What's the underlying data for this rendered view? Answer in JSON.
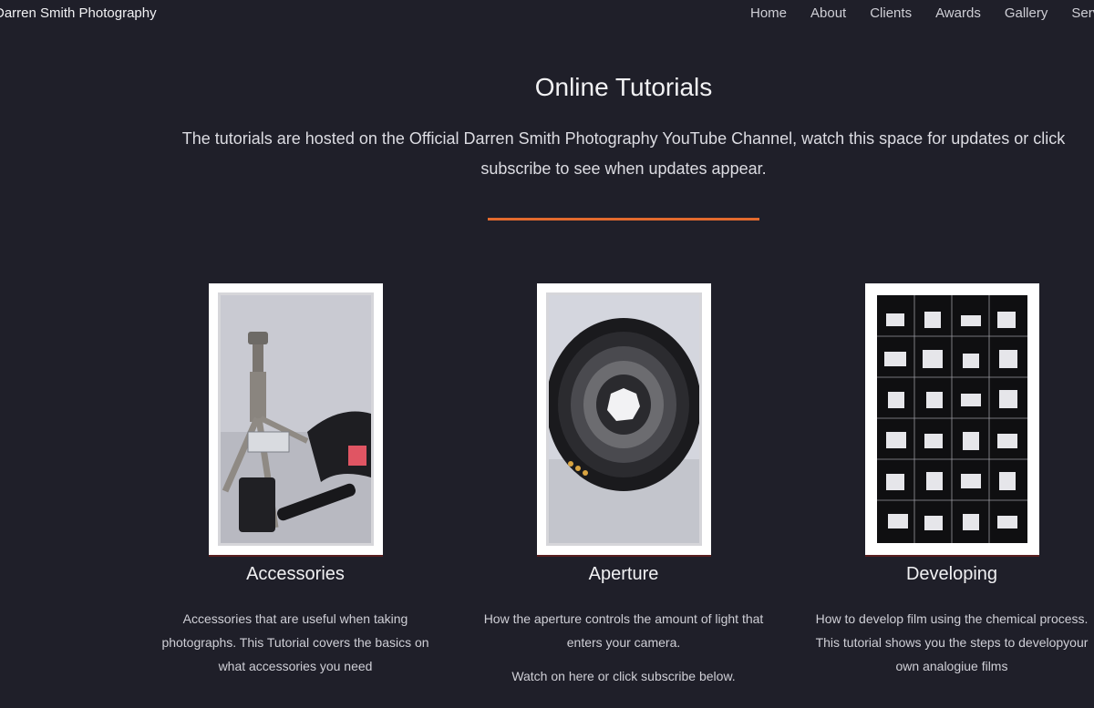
{
  "header": {
    "brand": "Darren Smith Photography",
    "nav": [
      "Home",
      "About",
      "Clients",
      "Awards",
      "Gallery",
      "Services"
    ]
  },
  "main": {
    "title": "Online Tutorials",
    "intro": "The tutorials are hosted on the Official Darren Smith Photography YouTube Channel, watch this space for updates or click subscribe to see when updates appear.",
    "accent_color": "#e36a2e"
  },
  "cards": [
    {
      "title": "Accessories",
      "description": "Accessories that are useful when taking photographs. This Tutorial covers the basics on what accessories you need",
      "watch": ""
    },
    {
      "title": "Aperture",
      "description": "How the aperture controls the amount of light that enters your camera.",
      "watch": "Watch on here or click subscribe below."
    },
    {
      "title": "Developing",
      "description": "How to develop film using the chemical process. This tutorial shows you the steps to developyour own analogiue films",
      "watch": ""
    }
  ]
}
